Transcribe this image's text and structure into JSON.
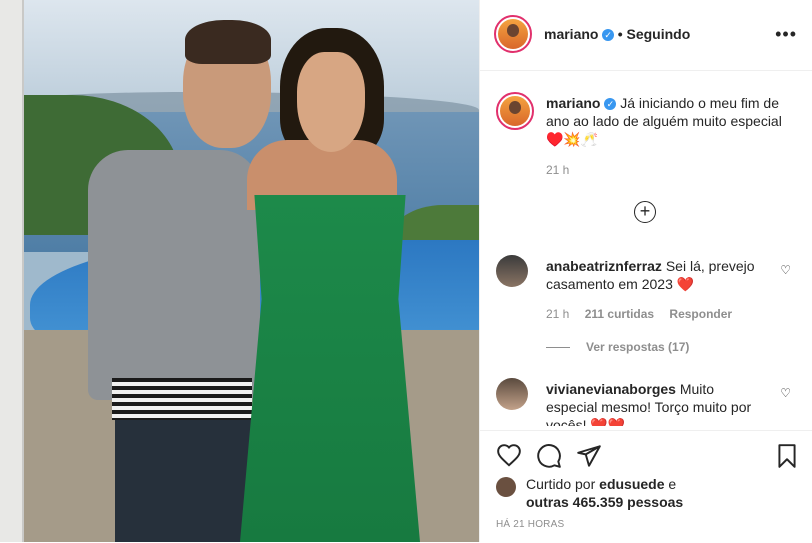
{
  "header": {
    "username": "mariano",
    "follow_status": "• Seguindo",
    "more_icon": "more-horizontal-icon"
  },
  "caption": {
    "username": "mariano",
    "text": "Já iniciando o meu fim de ano ao lado de alguém muito especial ♥️💥🥂",
    "time": "21 h"
  },
  "comments": [
    {
      "username": "anabeatriznferraz",
      "text": "Sei lá, prevejo casamento em 2023 ❤️",
      "time": "21 h",
      "likes": "211 curtidas",
      "reply": "Responder",
      "view_replies": "Ver respostas (17)"
    },
    {
      "username": "vivianevianaborges",
      "text": "Muito especial mesmo! Torço muito por vocês! ❤️❤️"
    }
  ],
  "likes": {
    "prefix": "Curtido por",
    "user": "edusuede",
    "connector": "e",
    "others": "outras 465.359 pessoas"
  },
  "post_time": "HÁ 21 HORAS",
  "colors": {
    "verified": "#3897f0",
    "heart": "#ed4956",
    "story_ring": "#e1306c"
  }
}
